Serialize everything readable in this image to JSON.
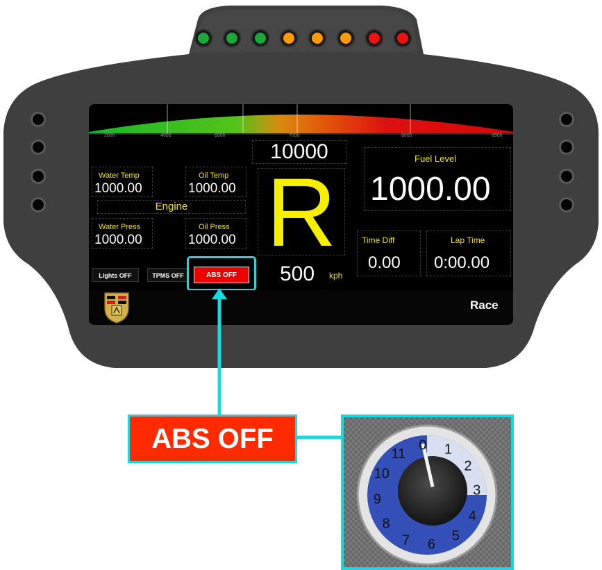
{
  "shift_lights": [
    "#1aa83a",
    "#1aa83a",
    "#1aa83a",
    "#ff9b00",
    "#ff9b00",
    "#ff9b00",
    "#ee1111",
    "#ee1111"
  ],
  "rpm_ticks": [
    "2000",
    "4000",
    "6000",
    "7000",
    "8000",
    "8500"
  ],
  "engine": {
    "title": "Engine",
    "water_temp_label": "Water Temp",
    "water_temp_value": "1000.00",
    "oil_temp_label": "Oil Temp",
    "oil_temp_value": "1000.00",
    "water_press_label": "Water Press",
    "water_press_value": "1000.00",
    "oil_press_label": "Oil Press",
    "oil_press_value": "1000.00"
  },
  "center": {
    "rpm": "10000",
    "gear": "R",
    "speed": "500",
    "speed_unit": "kph"
  },
  "fuel": {
    "label": "Fuel Level",
    "value": "1000.00"
  },
  "timing": {
    "time_diff_label": "Time Diff",
    "time_diff_value": "0.00",
    "lap_time_label": "Lap Time",
    "lap_time_value": "0:00.00"
  },
  "toggles": {
    "lights": "Lights OFF",
    "tpms": "TPMS OFF",
    "abs": "ABS OFF"
  },
  "mode": "Race",
  "callout": {
    "label": "ABS OFF"
  },
  "knob_dial": {
    "numbers": [
      "0",
      "1",
      "2",
      "3",
      "4",
      "5",
      "6",
      "7",
      "8",
      "9",
      "10",
      "11"
    ],
    "selected": "0"
  },
  "colors": {
    "accent_cyan": "#18d8e0",
    "abs_red": "#ff2a00",
    "text_yellow": "#f2e300"
  }
}
